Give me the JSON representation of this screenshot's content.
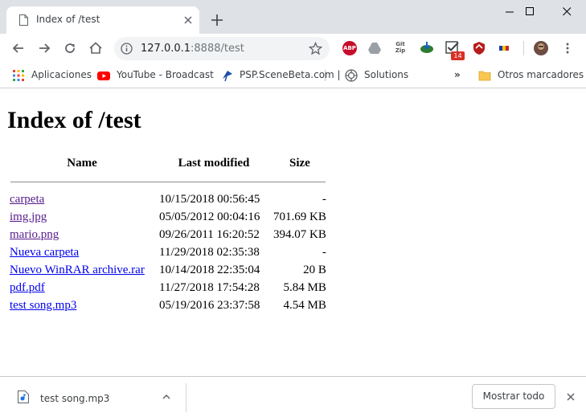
{
  "tab": {
    "title": "Index of /test",
    "favicon": "page-icon"
  },
  "toolbar": {
    "url_host": "127.0.0.1",
    "url_rest": ":8888/test",
    "extension_badge": "14"
  },
  "bookmarks": [
    {
      "label": "Aplicaciones",
      "icon": "apps-grid-icon"
    },
    {
      "label": "YouTube - Broadcast",
      "icon": "youtube-icon"
    },
    {
      "label": "PSP.SceneBeta.com |",
      "icon": "psp-icon"
    },
    {
      "label": "Solutions",
      "icon": "solutions-icon"
    }
  ],
  "bookmarks_overflow": "»",
  "other_bookmarks": "Otros marcadores",
  "page": {
    "heading": "Index of /test",
    "columns": {
      "name": "Name",
      "modified": "Last modified",
      "size": "Size"
    },
    "files": [
      {
        "name": "carpeta",
        "modified": "10/15/2018 00:56:45",
        "size": "-",
        "visited": true
      },
      {
        "name": "img.jpg",
        "modified": "05/05/2012 00:04:16",
        "size": "701.69 KB",
        "visited": true
      },
      {
        "name": "mario.png",
        "modified": "09/26/2011 16:20:52",
        "size": "394.07 KB",
        "visited": true
      },
      {
        "name": "Nueva carpeta",
        "modified": "11/29/2018 02:35:38",
        "size": "-",
        "visited": false
      },
      {
        "name": "Nuevo WinRAR archive.rar",
        "modified": "10/14/2018 22:35:04",
        "size": "20 B",
        "visited": false
      },
      {
        "name": "pdf.pdf",
        "modified": "11/27/2018 17:54:28",
        "size": "5.84 MB",
        "visited": false
      },
      {
        "name": "test song.mp3",
        "modified": "05/19/2016 23:37:58",
        "size": "4.54 MB",
        "visited": false
      }
    ]
  },
  "downloads": {
    "file_name": "test song.mp3",
    "show_all_label": "Mostrar todo"
  },
  "colors": {
    "tabstrip_bg": "#dee1e6",
    "link": "#0000ee",
    "link_visited": "#551a8b",
    "omnibox_bg": "#f1f3f4"
  }
}
